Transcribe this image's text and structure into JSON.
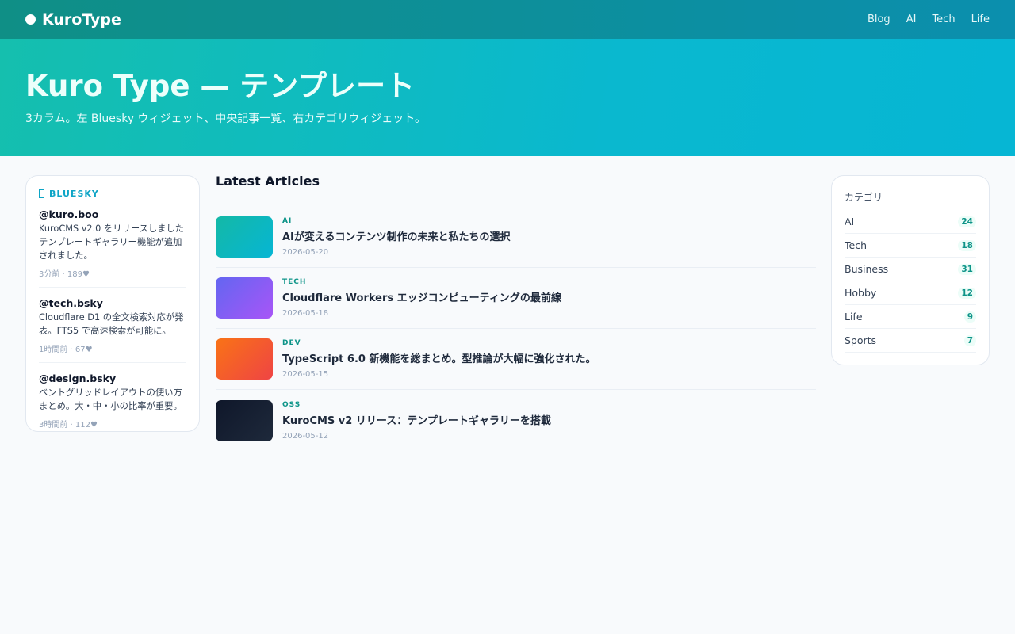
{
  "header": {
    "brand": "KuroType",
    "nav": [
      "Blog",
      "AI",
      "Tech",
      "Life"
    ]
  },
  "hero": {
    "title": "Kuro Type — テンプレート",
    "subtitle": "3カラム。左 Bluesky ウィジェット、中央記事一覧、右カテゴリウィジェット。"
  },
  "bluesky": {
    "label": "BLUESKY",
    "posts": [
      {
        "handle": "@kuro.boo",
        "text": "KuroCMS v2.0 をリリースしました  テンプレートギャラリー機能が追加されました。",
        "meta": "3分前 · 189♥"
      },
      {
        "handle": "@tech.bsky",
        "text": "Cloudflare D1 の全文検索対応が発表。FTS5 で高速検索が可能に。",
        "meta": "1時間前 · 67♥"
      },
      {
        "handle": "@design.bsky",
        "text": "ベントグリッドレイアウトの使い方まとめ。大・中・小の比率が重要。",
        "meta": "3時間前 · 112♥"
      }
    ]
  },
  "articles": {
    "title": "Latest Articles",
    "items": [
      {
        "tag": "AI",
        "title": "AIが変えるコンテンツ制作の未来と私たちの選択",
        "date": "2026-05-20",
        "color1": "#14b8a6",
        "color2": "#06b6d4"
      },
      {
        "tag": "TECH",
        "title": "Cloudflare Workers エッジコンピューティングの最前線",
        "date": "2026-05-18",
        "color1": "#6366f1",
        "color2": "#a855f7"
      },
      {
        "tag": "DEV",
        "title": "TypeScript 6.0 新機能を総まとめ。型推論が大幅に強化された。",
        "date": "2026-05-15",
        "color1": "#f97316",
        "color2": "#ef4444"
      },
      {
        "tag": "OSS",
        "title": "KuroCMS v2 リリース：テンプレートギャラリーを搭載",
        "date": "2026-05-12",
        "color1": "#0f172a",
        "color2": "#1e293b"
      }
    ]
  },
  "categories": {
    "title": "カテゴリ",
    "items": [
      {
        "name": "AI",
        "count": "24"
      },
      {
        "name": "Tech",
        "count": "18"
      },
      {
        "name": "Business",
        "count": "31"
      },
      {
        "name": "Hobby",
        "count": "12"
      },
      {
        "name": "Life",
        "count": "9"
      },
      {
        "name": "Sports",
        "count": "7"
      }
    ]
  }
}
